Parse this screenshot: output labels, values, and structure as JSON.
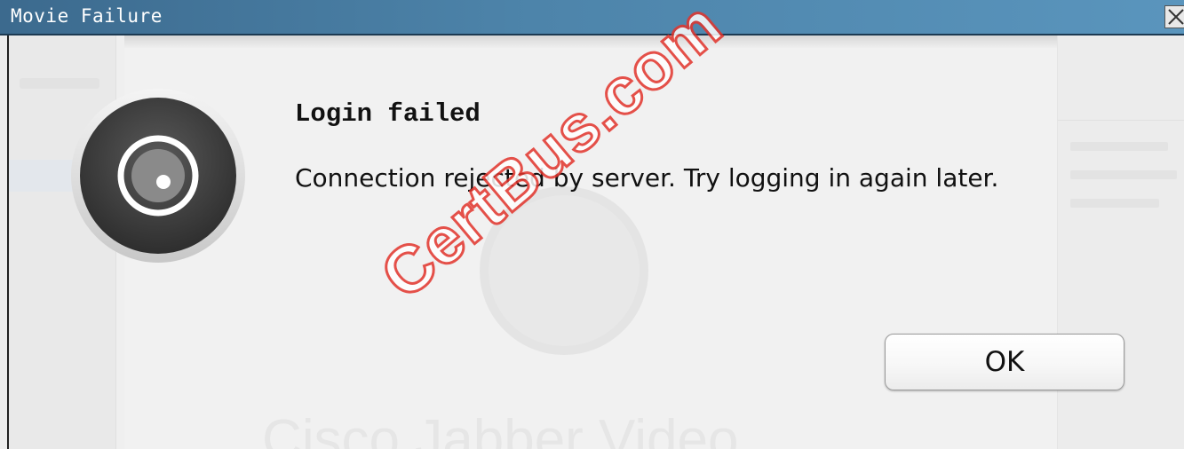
{
  "window": {
    "title": "Movie Failure",
    "close_icon": "close-icon"
  },
  "dialog": {
    "icon": "camera-lens-icon",
    "title": "Login failed",
    "message": "Connection rejected by server. Try logging in again later.",
    "ok_label": "OK"
  },
  "background_app": {
    "brand_text": "Cisco Jabber Video"
  },
  "watermark": {
    "text": "CertBus.com",
    "color": "#e2342c"
  }
}
